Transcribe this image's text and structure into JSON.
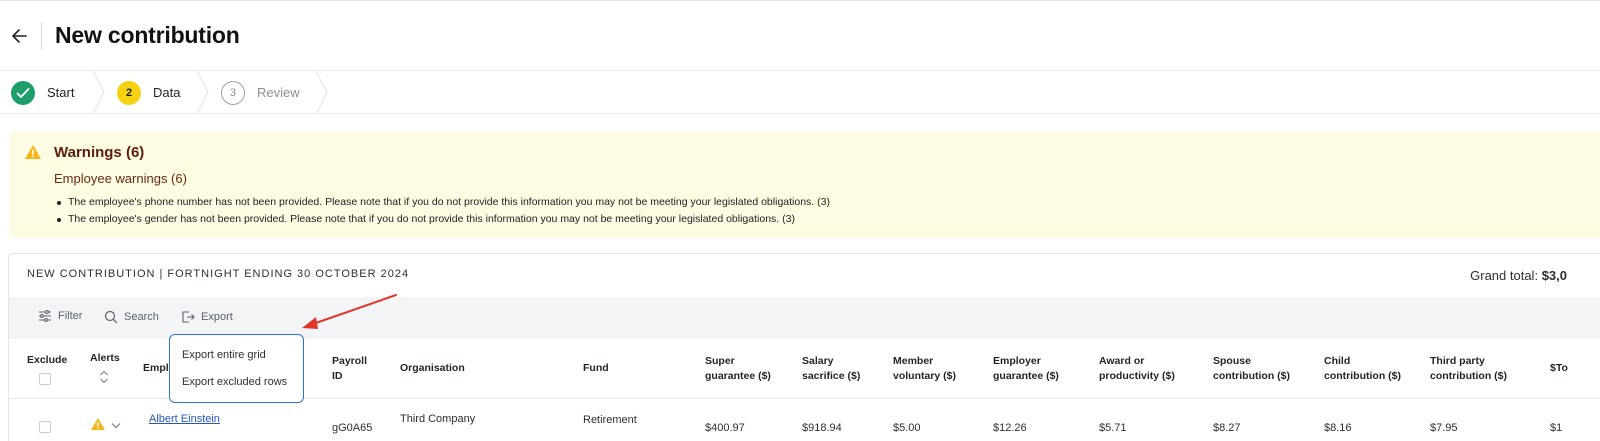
{
  "header": {
    "title": "New contribution"
  },
  "stepper": {
    "steps": [
      {
        "label": "Start",
        "number": "",
        "state": "complete"
      },
      {
        "label": "Data",
        "number": "2",
        "state": "current"
      },
      {
        "label": "Review",
        "number": "3",
        "state": "upcoming"
      }
    ]
  },
  "warnings": {
    "title": "Warnings (6)",
    "subtitle": "Employee warnings (6)",
    "items": [
      "The employee's phone number has not been provided. Please note that if you do not provide this information you may not be meeting your legislated obligations. (3)",
      "The employee's gender has not been provided. Please note that if you do not provide this information you may not be meeting your legislated obligations. (3)"
    ]
  },
  "grid": {
    "title": "NEW CONTRIBUTION | FORTNIGHT ENDING 30 OCTOBER 2024",
    "grand_total_label": "Grand total:",
    "grand_total_value": "$3,0",
    "toolbar": {
      "filter": "Filter",
      "search": "Search",
      "export": "Export"
    },
    "export_menu": [
      "Export entire grid",
      "Export excluded rows"
    ],
    "columns": {
      "exclude": "Exclude",
      "alerts": "Alerts",
      "employee": "Empl",
      "payroll_id_1": "Payroll",
      "payroll_id_2": "ID",
      "organisation": "Organisation",
      "fund": "Fund",
      "super_1": "Super",
      "super_2": "guarantee ($)",
      "salary_1": "Salary",
      "salary_2": "sacrifice ($)",
      "member_1": "Member",
      "member_2": "voluntary ($)",
      "employer_1": "Employer",
      "employer_2": "guarantee ($)",
      "award_1": "Award or",
      "award_2": "productivity ($)",
      "spouse_1": "Spouse",
      "spouse_2": "contribution ($)",
      "child_1": "Child",
      "child_2": "contribution ($)",
      "third_1": "Third party",
      "third_2": "contribution ($)",
      "total": "$To"
    },
    "row": {
      "employee": "Albert Einstein",
      "payroll_id": "gG0A65",
      "organisation": "Third Company",
      "fund": "Retirement",
      "super": "$400.97",
      "salary": "$918.94",
      "member": "$5.00",
      "employer": "$12.26",
      "award": "$5.71",
      "spouse": "$8.27",
      "child": "$8.16",
      "third": "$7.95",
      "total": "$1"
    }
  },
  "colors": {
    "accent": "#2f6fd6",
    "success": "#1e9e6a",
    "current_step": "#f5d313",
    "warning_bg": "#fdfbe2",
    "warning_icon": "#f2b61b",
    "arrow": "#e0362c"
  },
  "icons": [
    "back-arrow-icon",
    "check-icon",
    "warning-icon",
    "filter-icon",
    "search-icon",
    "export-icon",
    "sort-icon",
    "chevron-down-icon"
  ]
}
